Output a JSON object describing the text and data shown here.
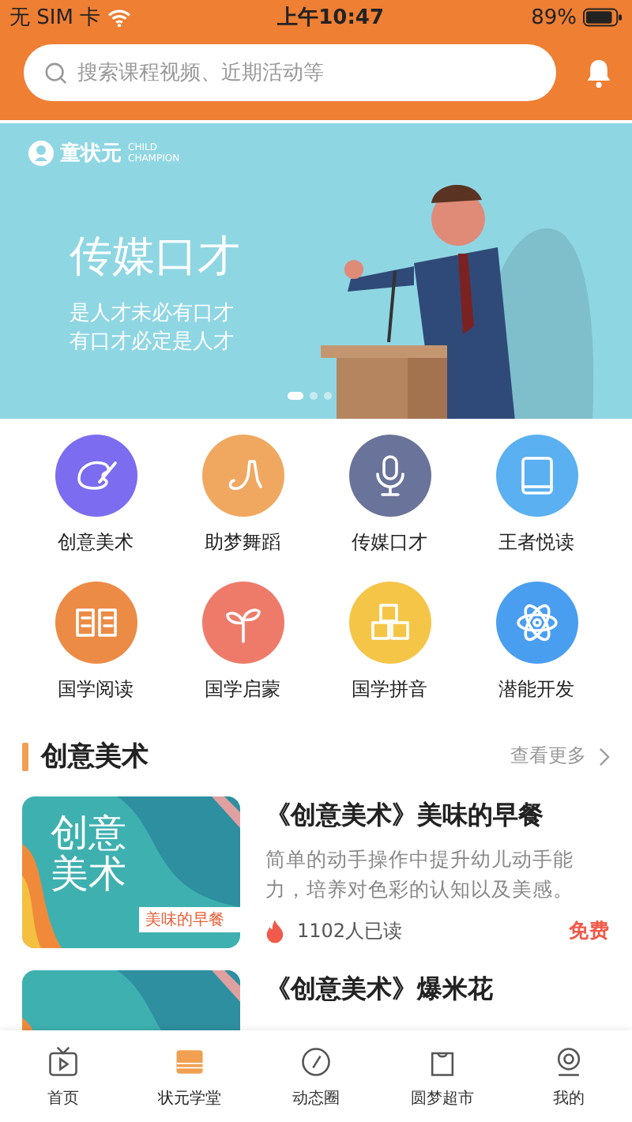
{
  "status_bar": {
    "carrier": "无 SIM 卡",
    "time": "上午10:47",
    "battery": "89%"
  },
  "search": {
    "placeholder": "搜索课程视频、近期活动等"
  },
  "banner": {
    "brand": "童状元",
    "brand_en": "CHILD CHAMPION",
    "headline": "传媒口才",
    "lines": [
      "是人才未必有口才",
      "有口才必定是人才"
    ],
    "dots": [
      {
        "selected": true
      },
      {
        "selected": false
      },
      {
        "selected": false
      }
    ]
  },
  "categories": [
    {
      "label": "创意美术",
      "color": "#7b6cf0"
    },
    {
      "label": "助梦舞蹈",
      "color": "#f0a860"
    },
    {
      "label": "传媒口才",
      "color": "#6a7399"
    },
    {
      "label": "王者悦读",
      "color": "#5ab0f0"
    },
    {
      "label": "国学阅读",
      "color": "#ec8b45"
    },
    {
      "label": "国学启蒙",
      "color": "#ee7b6a"
    },
    {
      "label": "国学拼音",
      "color": "#f5c548"
    },
    {
      "label": "潜能开发",
      "color": "#4a9ef0"
    }
  ],
  "section": {
    "title": "创意美术",
    "more": "查看更多"
  },
  "courses": [
    {
      "thumb_title": "创意美术",
      "thumb_tag": "美味的早餐",
      "title": "《创意美术》美味的早餐",
      "description": "简单的动手操作中提升幼儿动手能力，培养对色彩的认知以及美感。",
      "reads": "1102人已读",
      "price": "免费"
    },
    {
      "title": "《创意美术》爆米花"
    }
  ],
  "tabs": [
    {
      "label": "首页",
      "selected": false
    },
    {
      "label": "状元学堂",
      "selected": true
    },
    {
      "label": "动态圈",
      "selected": false
    },
    {
      "label": "圆梦超市",
      "selected": false
    },
    {
      "label": "我的",
      "selected": false
    }
  ]
}
